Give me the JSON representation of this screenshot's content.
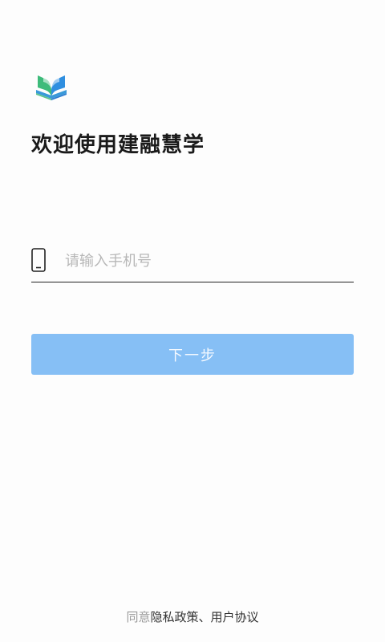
{
  "app": {
    "logo_icon": "book-logo-icon",
    "welcome_title": "欢迎使用建融慧学"
  },
  "login": {
    "phone_icon": "mobile-phone-icon",
    "phone_placeholder": "请输入手机号",
    "phone_value": "",
    "next_label": "下一步",
    "next_button_color": "#86bff5"
  },
  "footer": {
    "agree_prefix": "同意",
    "privacy_link": "隐私政策",
    "separator": "、",
    "terms_link": "用户协议"
  },
  "colors": {
    "background": "#fdfdfd",
    "logo_green": "#3dbb7a",
    "logo_blue": "#2f8fe0",
    "title_text": "#1a1a1a"
  }
}
